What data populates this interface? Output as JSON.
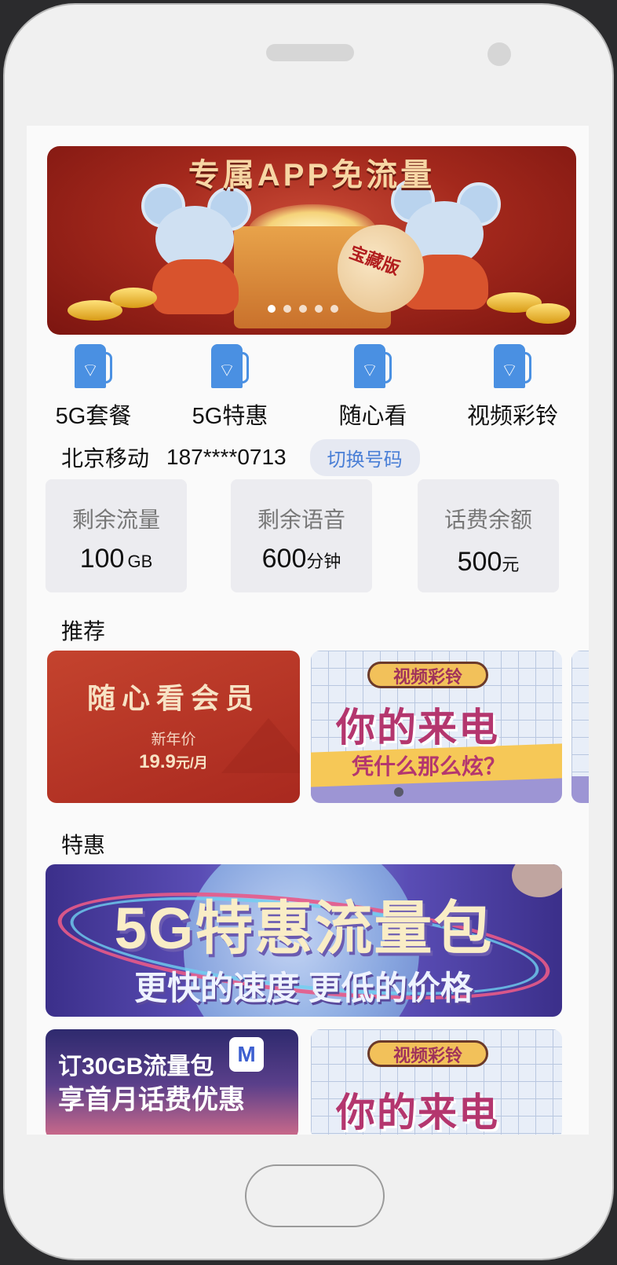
{
  "banner": {
    "title": "专属APP免流量",
    "bag_text": "宝藏版",
    "dots": 5,
    "active_dot": 0
  },
  "quick_actions": [
    {
      "label": "5G套餐",
      "icon": "fuel-pump-wifi-icon"
    },
    {
      "label": "5G特惠",
      "icon": "fuel-pump-wifi-icon"
    },
    {
      "label": "随心看",
      "icon": "fuel-pump-wifi-icon"
    },
    {
      "label": "视频彩铃",
      "icon": "fuel-pump-wifi-icon"
    }
  ],
  "account": {
    "carrier": "北京移动",
    "number": "187****0713",
    "switch_label": "切换号码"
  },
  "stats": [
    {
      "label": "剩余流量",
      "value": "100",
      "unit": "GB"
    },
    {
      "label": "剩余语音",
      "value": "600",
      "unit": "分钟"
    },
    {
      "label": "话费余额",
      "value": "500",
      "unit": "元"
    }
  ],
  "recommend": {
    "title": "推荐",
    "card1": {
      "title": "随心看会员",
      "subtitle": "新年价",
      "price": "19.9",
      "price_unit": "元/月"
    },
    "card2": {
      "tag": "视频彩铃",
      "headline": "你的来电",
      "sub": "凭什么那么炫？"
    }
  },
  "special": {
    "title": "特惠",
    "banner_title": "5G特惠流量包",
    "banner_sub": "更快的速度 更低的价格"
  },
  "bottom_cards": {
    "card1": {
      "line1": "订30GB流量包",
      "line2": "享首月话费优惠",
      "logo": "M"
    },
    "card2": {
      "tag": "视频彩铃",
      "headline": "你的来电"
    }
  },
  "colors": {
    "accent_blue": "#4a90e2",
    "switch_text": "#4a7fd6",
    "banner_red": "#a3281c"
  }
}
